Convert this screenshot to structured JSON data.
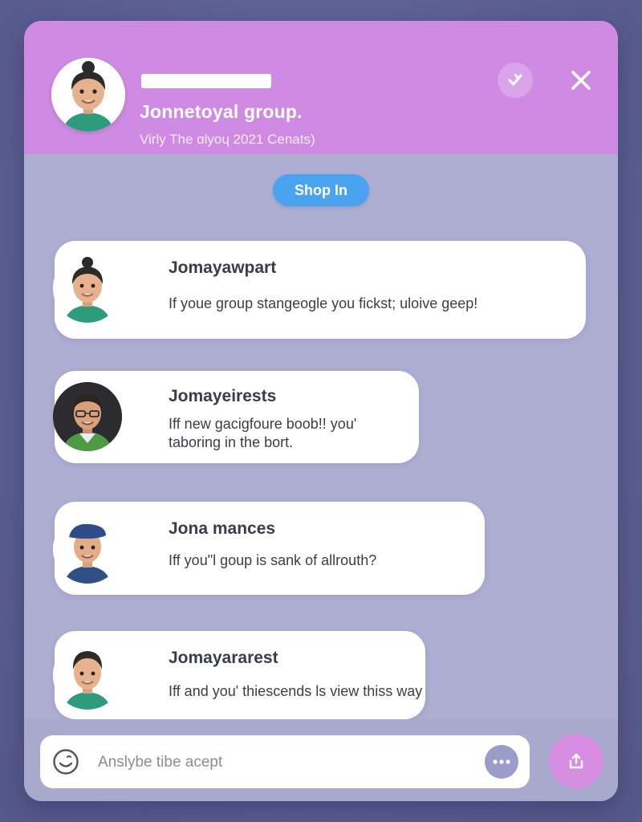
{
  "header": {
    "group_name": "Jonnetoyal group.",
    "subtitle": "Virly The ɑlyoɥ 2021 Cenats)"
  },
  "actions": {
    "shop_label": "Shop In"
  },
  "messages": [
    {
      "name": "Jomayawpart",
      "text": "If youe group stangeogle you fickst; uloive geep!"
    },
    {
      "name": "Jomayeirests",
      "text": "Iff new gacigfoure boob!! you' taboring in the bort."
    },
    {
      "name": "Jona mances",
      "text": "Iff you\"l goup is sank of allrouth?"
    },
    {
      "name": "Jomayararest",
      "text": "Iff and you' thiescends ls view thiss way"
    }
  ],
  "composer": {
    "placeholder": "Anslybe tibe acept"
  },
  "colors": {
    "header": "#cf8be3",
    "panel": "#aeaed3",
    "shop_button": "#4aa3ee",
    "send_button": "#d78ee2",
    "background": "#5f6394"
  },
  "icons": {
    "check": "check-icon",
    "close": "close-icon",
    "emoji": "smiley-icon",
    "more": "more-dots-icon",
    "send": "share-icon"
  }
}
